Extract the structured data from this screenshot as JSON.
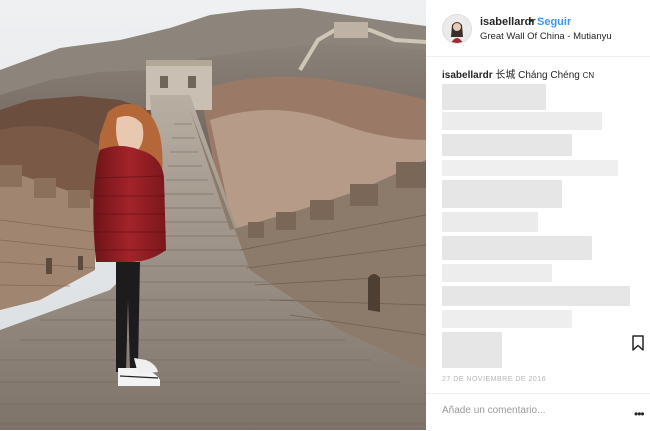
{
  "post": {
    "username": "isabellardr",
    "separator": "•",
    "follow_label": "Seguir",
    "location": "Great Wall Of China - Mutianyu",
    "caption_user": "isabellardr",
    "caption_text": "长城 Cháng Chéng",
    "caption_flag": "CN",
    "date": "27 de noviembre de 2016",
    "comment_placeholder": "Añade un comentario...",
    "more_label": "•••"
  },
  "icons": {
    "save": "bookmark-icon",
    "more": "more-options-icon"
  },
  "colors": {
    "follow": "#3897f0",
    "text": "#262626",
    "muted": "#999999"
  }
}
